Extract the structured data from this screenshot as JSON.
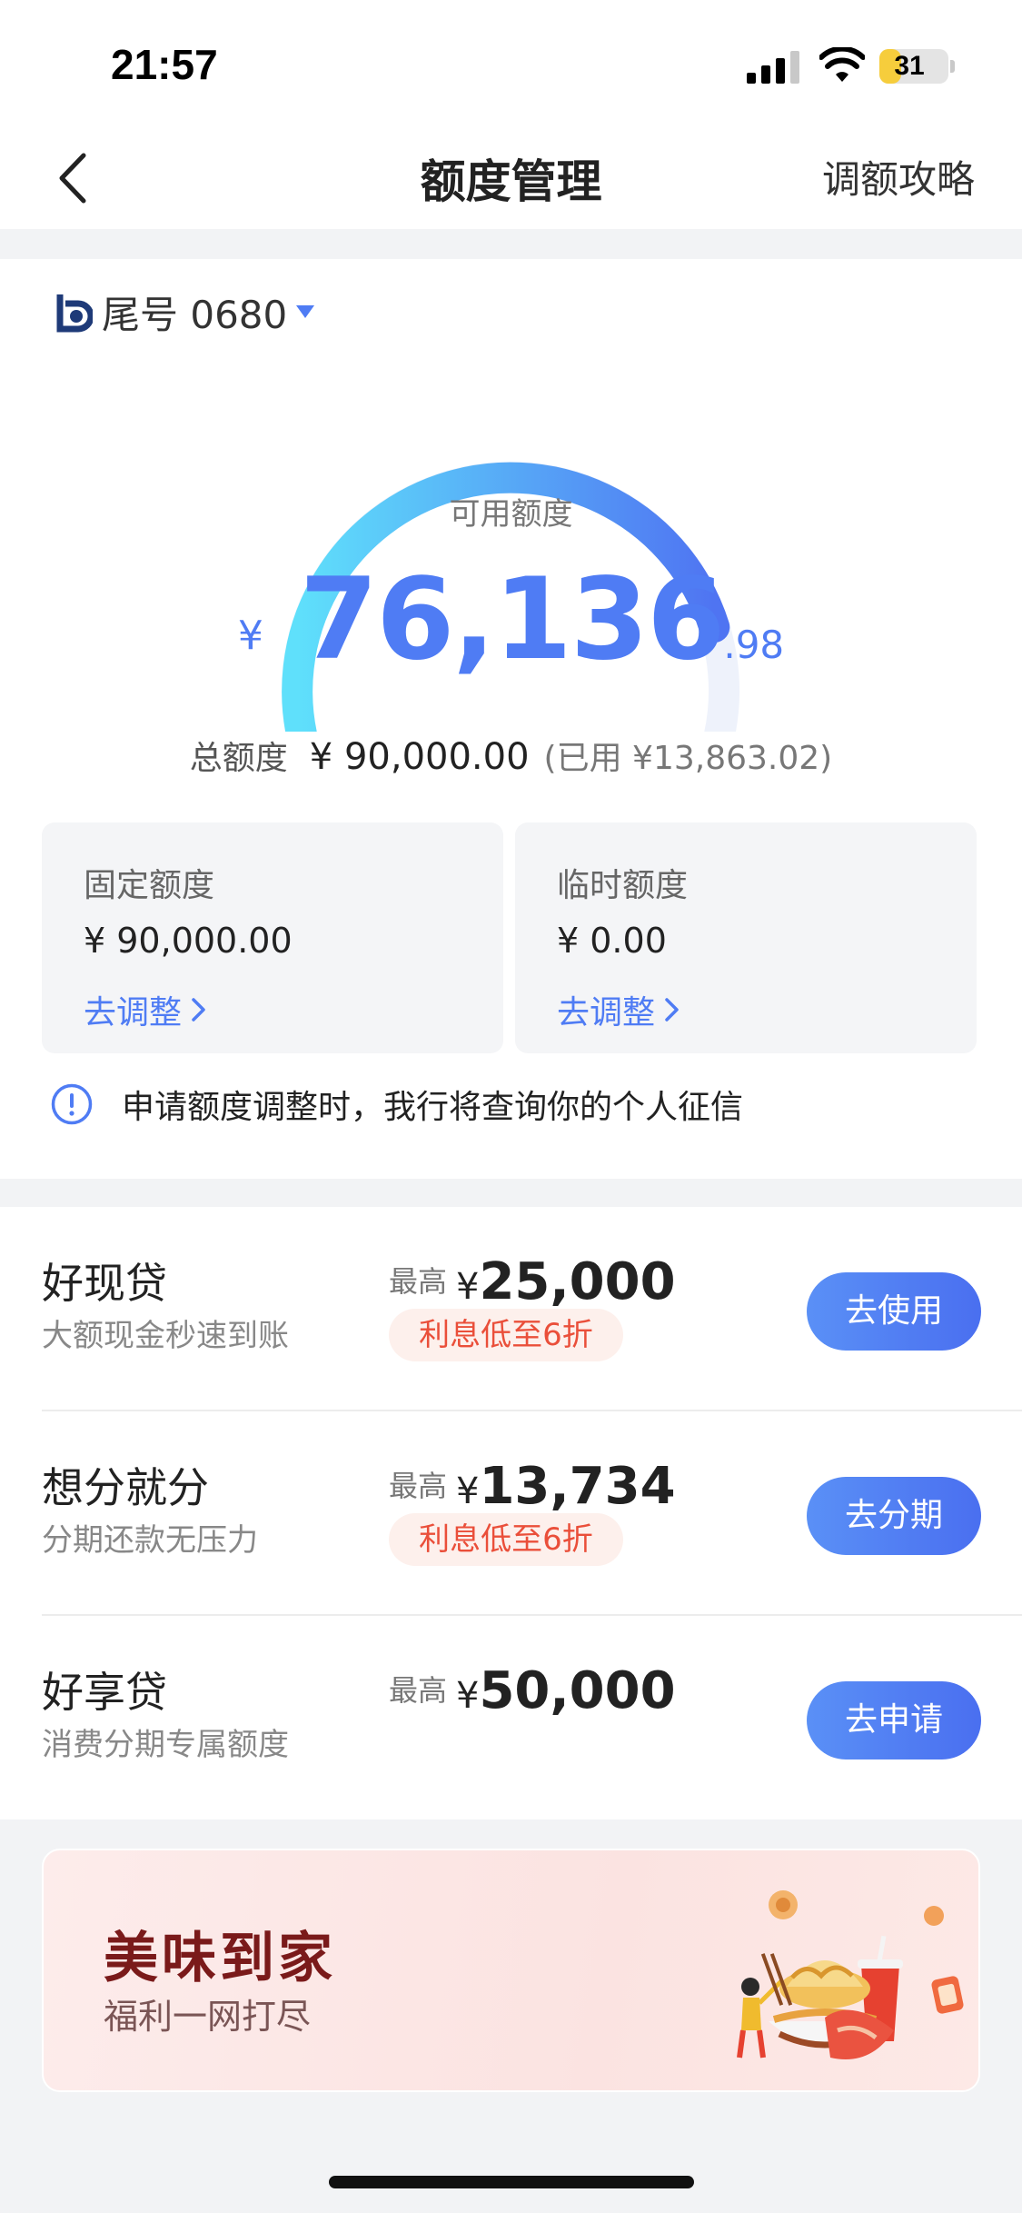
{
  "status_bar": {
    "time": "21:57",
    "battery": "31",
    "battery_level_fraction": 0.31
  },
  "nav": {
    "title": "额度管理",
    "right_link": "调额攻略"
  },
  "account": {
    "label": "尾号 0680"
  },
  "quota": {
    "available_label": "可用额度",
    "currency_symbol": "¥",
    "available_int": "76,136",
    "available_dec": ".98",
    "used_fraction": 0.154,
    "total_label": "总额度",
    "total_value": "¥ 90,000.00",
    "used_text": "(已用 ¥13,863.02)",
    "colors": {
      "gauge_start": "#5fe0fb",
      "gauge_end": "#4f74f2",
      "gauge_track": "#eef2fb"
    }
  },
  "sub_quotas": [
    {
      "title": "固定额度",
      "value": "¥ 90,000.00",
      "action": "去调整"
    },
    {
      "title": "临时额度",
      "value": "¥ 0.00",
      "action": "去调整"
    }
  ],
  "notice": {
    "text": "申请额度调整时，我行将查询你的个人征信"
  },
  "products": [
    {
      "name": "好现贷",
      "desc": "大额现金秒速到账",
      "max_label": "最高",
      "currency": "¥",
      "max_amount": "25,000",
      "tag": "利息低至6折",
      "button": "去使用"
    },
    {
      "name": "想分就分",
      "desc": "分期还款无压力",
      "max_label": "最高",
      "currency": "¥",
      "max_amount": "13,734",
      "tag": "利息低至6折",
      "button": "去分期"
    },
    {
      "name": "好享贷",
      "desc": "消费分期专属额度",
      "max_label": "最高",
      "currency": "¥",
      "max_amount": "50,000",
      "tag": "",
      "button": "去申请"
    }
  ],
  "banner": {
    "title": "美味到家",
    "subtitle": "福利一网打尽"
  }
}
